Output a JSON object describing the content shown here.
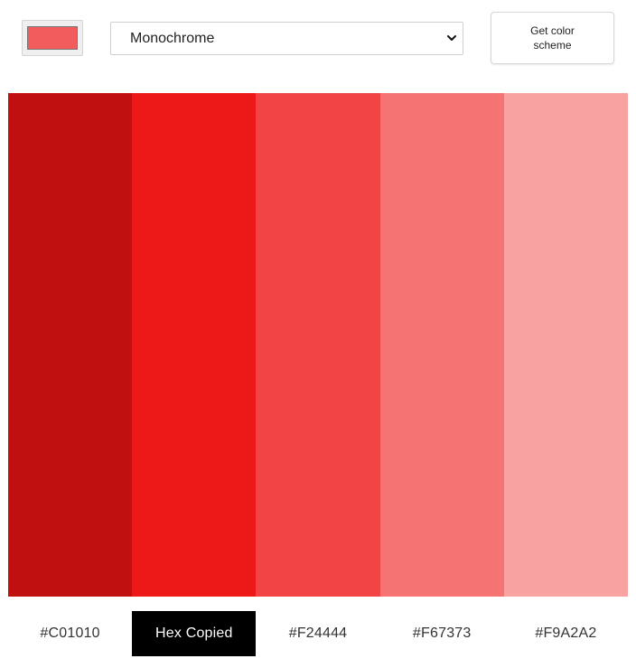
{
  "picker": {
    "selected_color": "#F25C5C",
    "swatch_border": "#767676"
  },
  "scheme_select": {
    "value": "Monochrome",
    "icon": "chevron-down-icon"
  },
  "get_button": {
    "label": "Get color scheme"
  },
  "palette": [
    {
      "hex": "#C01010",
      "color": "#C01010",
      "label": "#C01010",
      "copied": false
    },
    {
      "hex": "#F01919",
      "color": "#ED1919",
      "label": "Hex Copied",
      "copied": true
    },
    {
      "hex": "#F24444",
      "color": "#F24444",
      "label": "#F24444",
      "copied": false
    },
    {
      "hex": "#F67373",
      "color": "#F67373",
      "label": "#F67373",
      "copied": false
    },
    {
      "hex": "#F9A2A2",
      "color": "#F9A2A2",
      "label": "#F9A2A2",
      "copied": false
    }
  ]
}
